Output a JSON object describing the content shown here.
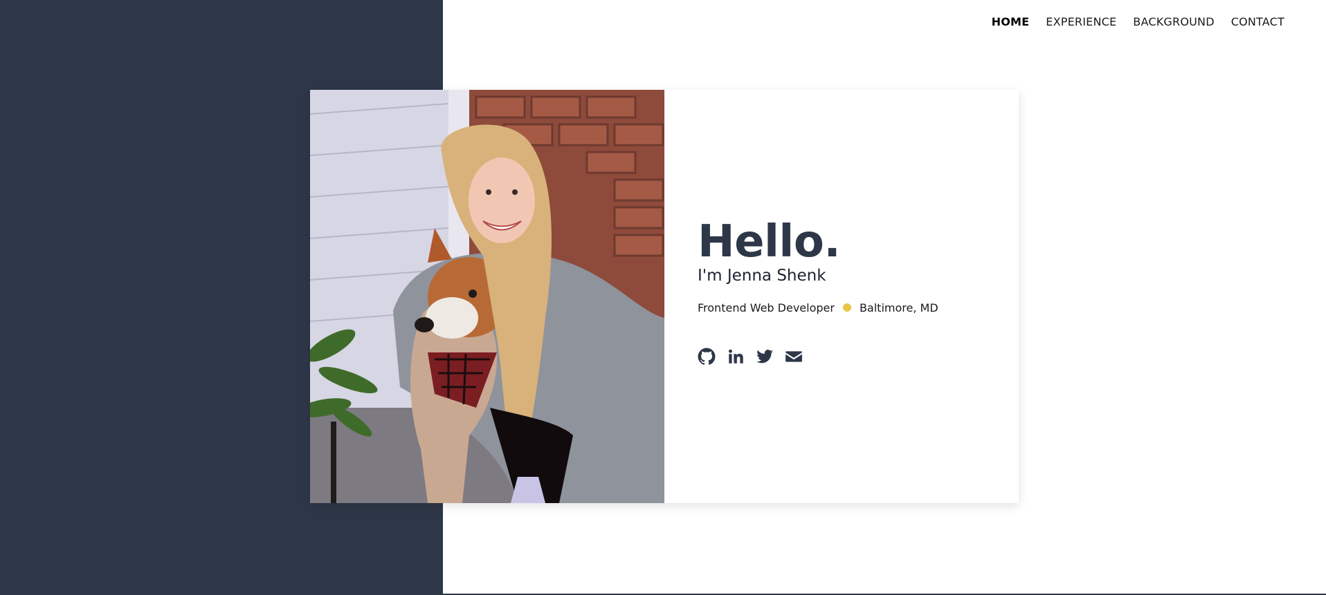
{
  "nav": {
    "items": [
      {
        "label": "HOME",
        "active": true
      },
      {
        "label": "EXPERIENCE",
        "active": false
      },
      {
        "label": "BACKGROUND",
        "active": false
      },
      {
        "label": "CONTACT",
        "active": false
      }
    ]
  },
  "hero": {
    "greeting": "Hello.",
    "intro": "I'm Jenna Shenk",
    "role": "Frontend Web Developer",
    "location": "Baltimore, MD",
    "photo_icon": "portrait-photo",
    "socials": [
      {
        "name": "github-icon"
      },
      {
        "name": "linkedin-icon"
      },
      {
        "name": "twitter-icon"
      },
      {
        "name": "email-icon"
      }
    ]
  },
  "colors": {
    "panel": "#2e3748",
    "accent_dot": "#e8c547"
  }
}
